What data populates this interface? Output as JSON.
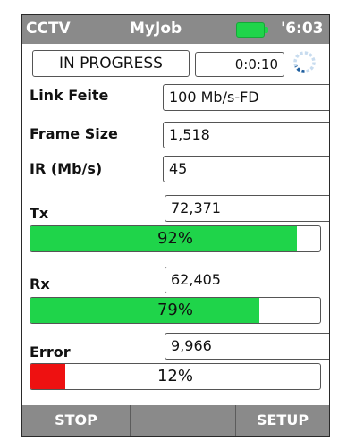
{
  "header": {
    "left": "CCTV",
    "job": "MyJob",
    "time": "'6:03"
  },
  "status": {
    "state": "IN PROGRESS",
    "elapsed": "0:0:10"
  },
  "fields": {
    "link_rate": {
      "label": "Link Feite",
      "value": "100 Mb/s-FD"
    },
    "frame_size": {
      "label": "Frame Size",
      "value": "1,518"
    },
    "ir": {
      "label": "IR (Mb/s)",
      "value": "45"
    }
  },
  "tx": {
    "label": "Tx",
    "value": "72,371",
    "percent_label": "92%",
    "percent": 92
  },
  "rx": {
    "label": "Rx",
    "value": "62,405",
    "percent_label": "79%",
    "percent": 79
  },
  "error": {
    "label": "Error",
    "value": "9,966",
    "percent_label": "12%",
    "percent": 12
  },
  "footer": {
    "stop": "STOP",
    "blank": "",
    "setup": "SETUP"
  },
  "colors": {
    "header_bg": "#8a8a8a",
    "progress_green": "#1fd44a",
    "error_red": "#ee1111",
    "battery": "#1fd44a"
  }
}
